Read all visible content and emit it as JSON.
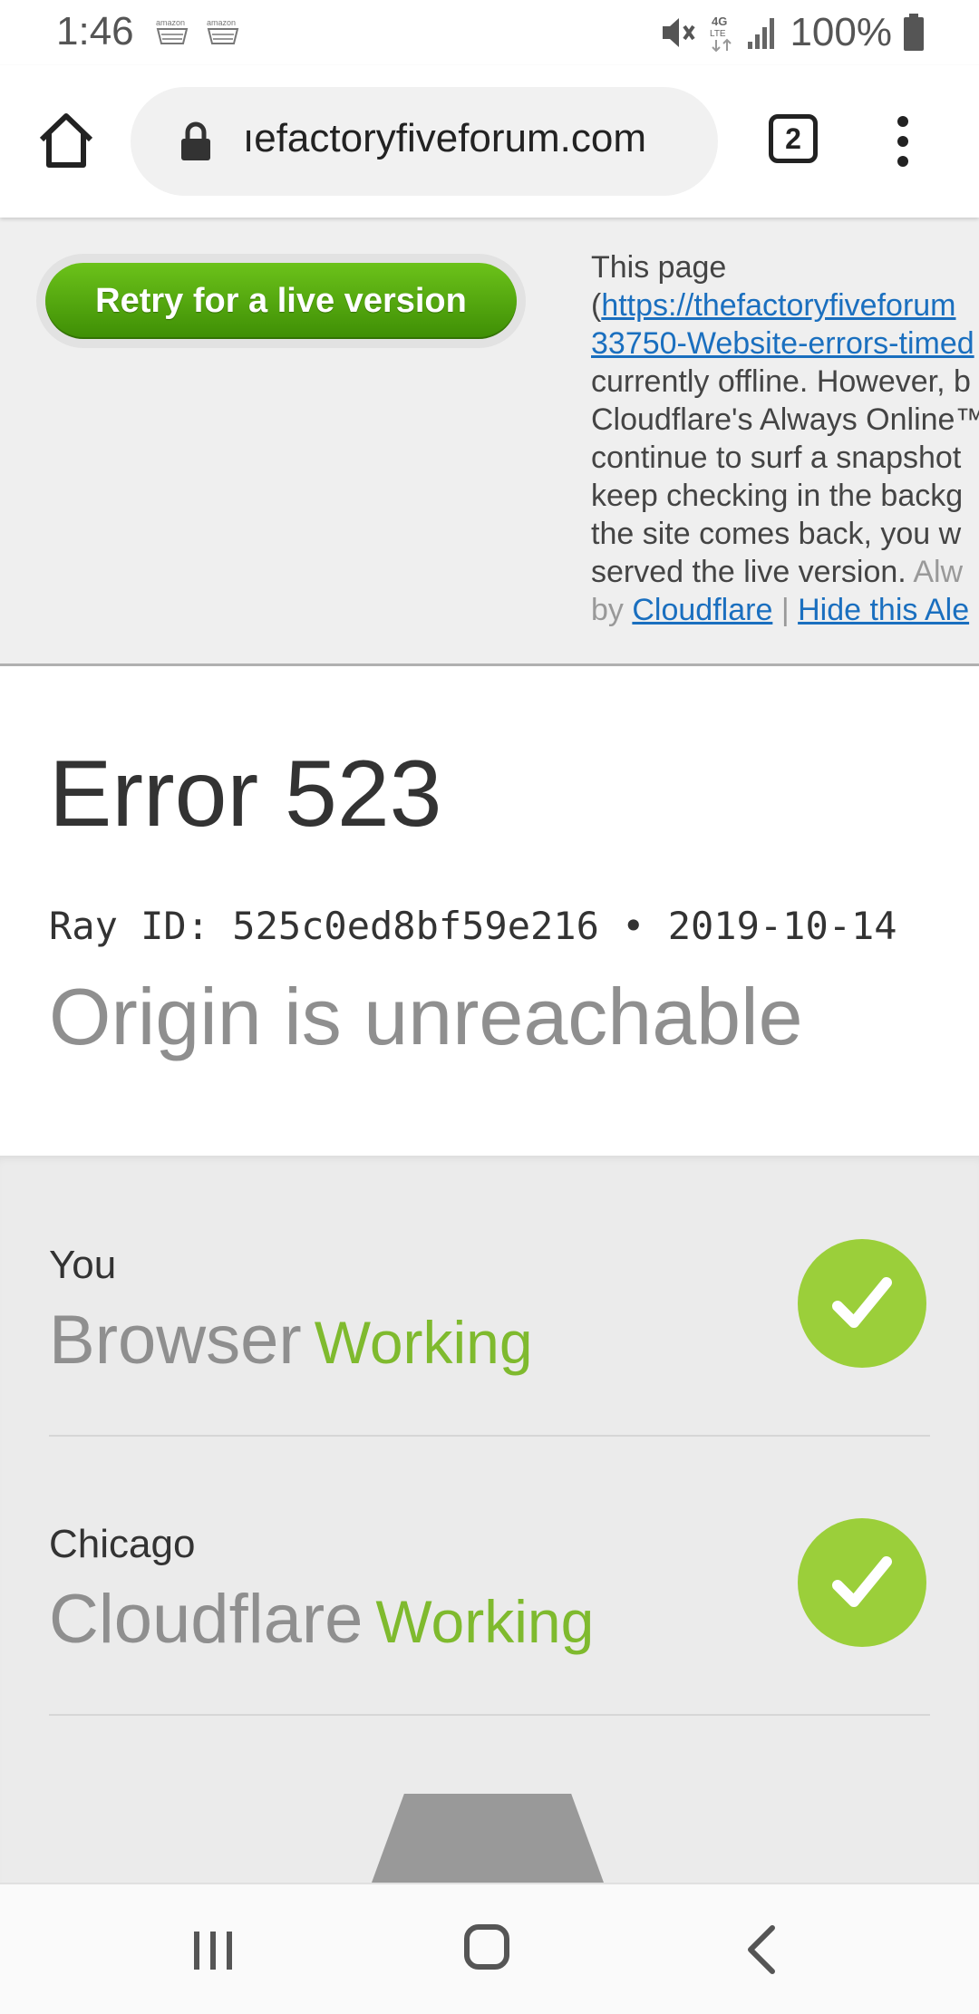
{
  "status_bar": {
    "time": "1:46",
    "notification_icons": [
      "amazon-icon",
      "amazon-icon"
    ],
    "battery": "100%",
    "icons": [
      "mute-icon",
      "4g-lte-icon",
      "signal-icon",
      "battery-icon"
    ]
  },
  "browser": {
    "url": "thefactoryfiveforum.com",
    "url_displayed": "ıefactoryfiveforum.com",
    "tab_count": "2"
  },
  "always_online": {
    "retry_label": "Retry for a live version",
    "lines": [
      "This page",
      "(",
      "https://thefactoryfiveforum",
      "33750-Website-errors-timed",
      "currently offline. However, b",
      "Cloudflare's Always Online™",
      "continue to surf a snapshot",
      "keep checking in the backg",
      "the site comes back, you w",
      "served the live version.",
      "Alw",
      "by",
      "Cloudflare",
      "|",
      "Hide this Ale"
    ]
  },
  "error": {
    "title": "Error 523",
    "ray_id": "Ray ID: 525c0ed8bf59e216 • 2019-10-14",
    "description": "Origin is unreachable"
  },
  "status_rows": [
    {
      "location": "You",
      "name": "Browser",
      "state": "Working"
    },
    {
      "location": "Chicago",
      "name": "Cloudflare",
      "state": "Working"
    }
  ],
  "colors": {
    "retry_green": "#4fa80f",
    "working_green": "#7fba2e",
    "check_green": "#9bcf3a",
    "link_blue": "#1a6fbf"
  }
}
